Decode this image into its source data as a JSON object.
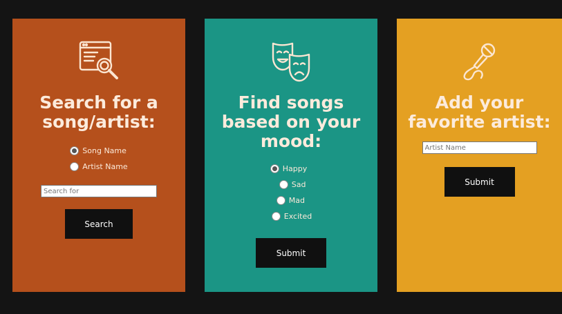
{
  "search_card": {
    "heading": "Search for a song/artist:",
    "options": [
      {
        "label": "Song Name",
        "checked": true
      },
      {
        "label": "Artist Name",
        "checked": false
      }
    ],
    "input_placeholder": "Search for",
    "button_label": "Search",
    "color": "#b5501c",
    "icon": "search-window-icon"
  },
  "mood_card": {
    "heading": "Find songs based on your mood:",
    "options": [
      {
        "label": "Happy",
        "checked": true
      },
      {
        "label": "Sad",
        "checked": false
      },
      {
        "label": "Mad",
        "checked": false
      },
      {
        "label": "Excited",
        "checked": false
      }
    ],
    "button_label": "Submit",
    "color": "#1b9585",
    "icon": "theater-masks-icon"
  },
  "artist_card": {
    "heading": "Add your favorite artist:",
    "input_placeholder": "Artist Name",
    "button_label": "Submit",
    "color": "#e4a022",
    "icon": "microphone-icon"
  }
}
